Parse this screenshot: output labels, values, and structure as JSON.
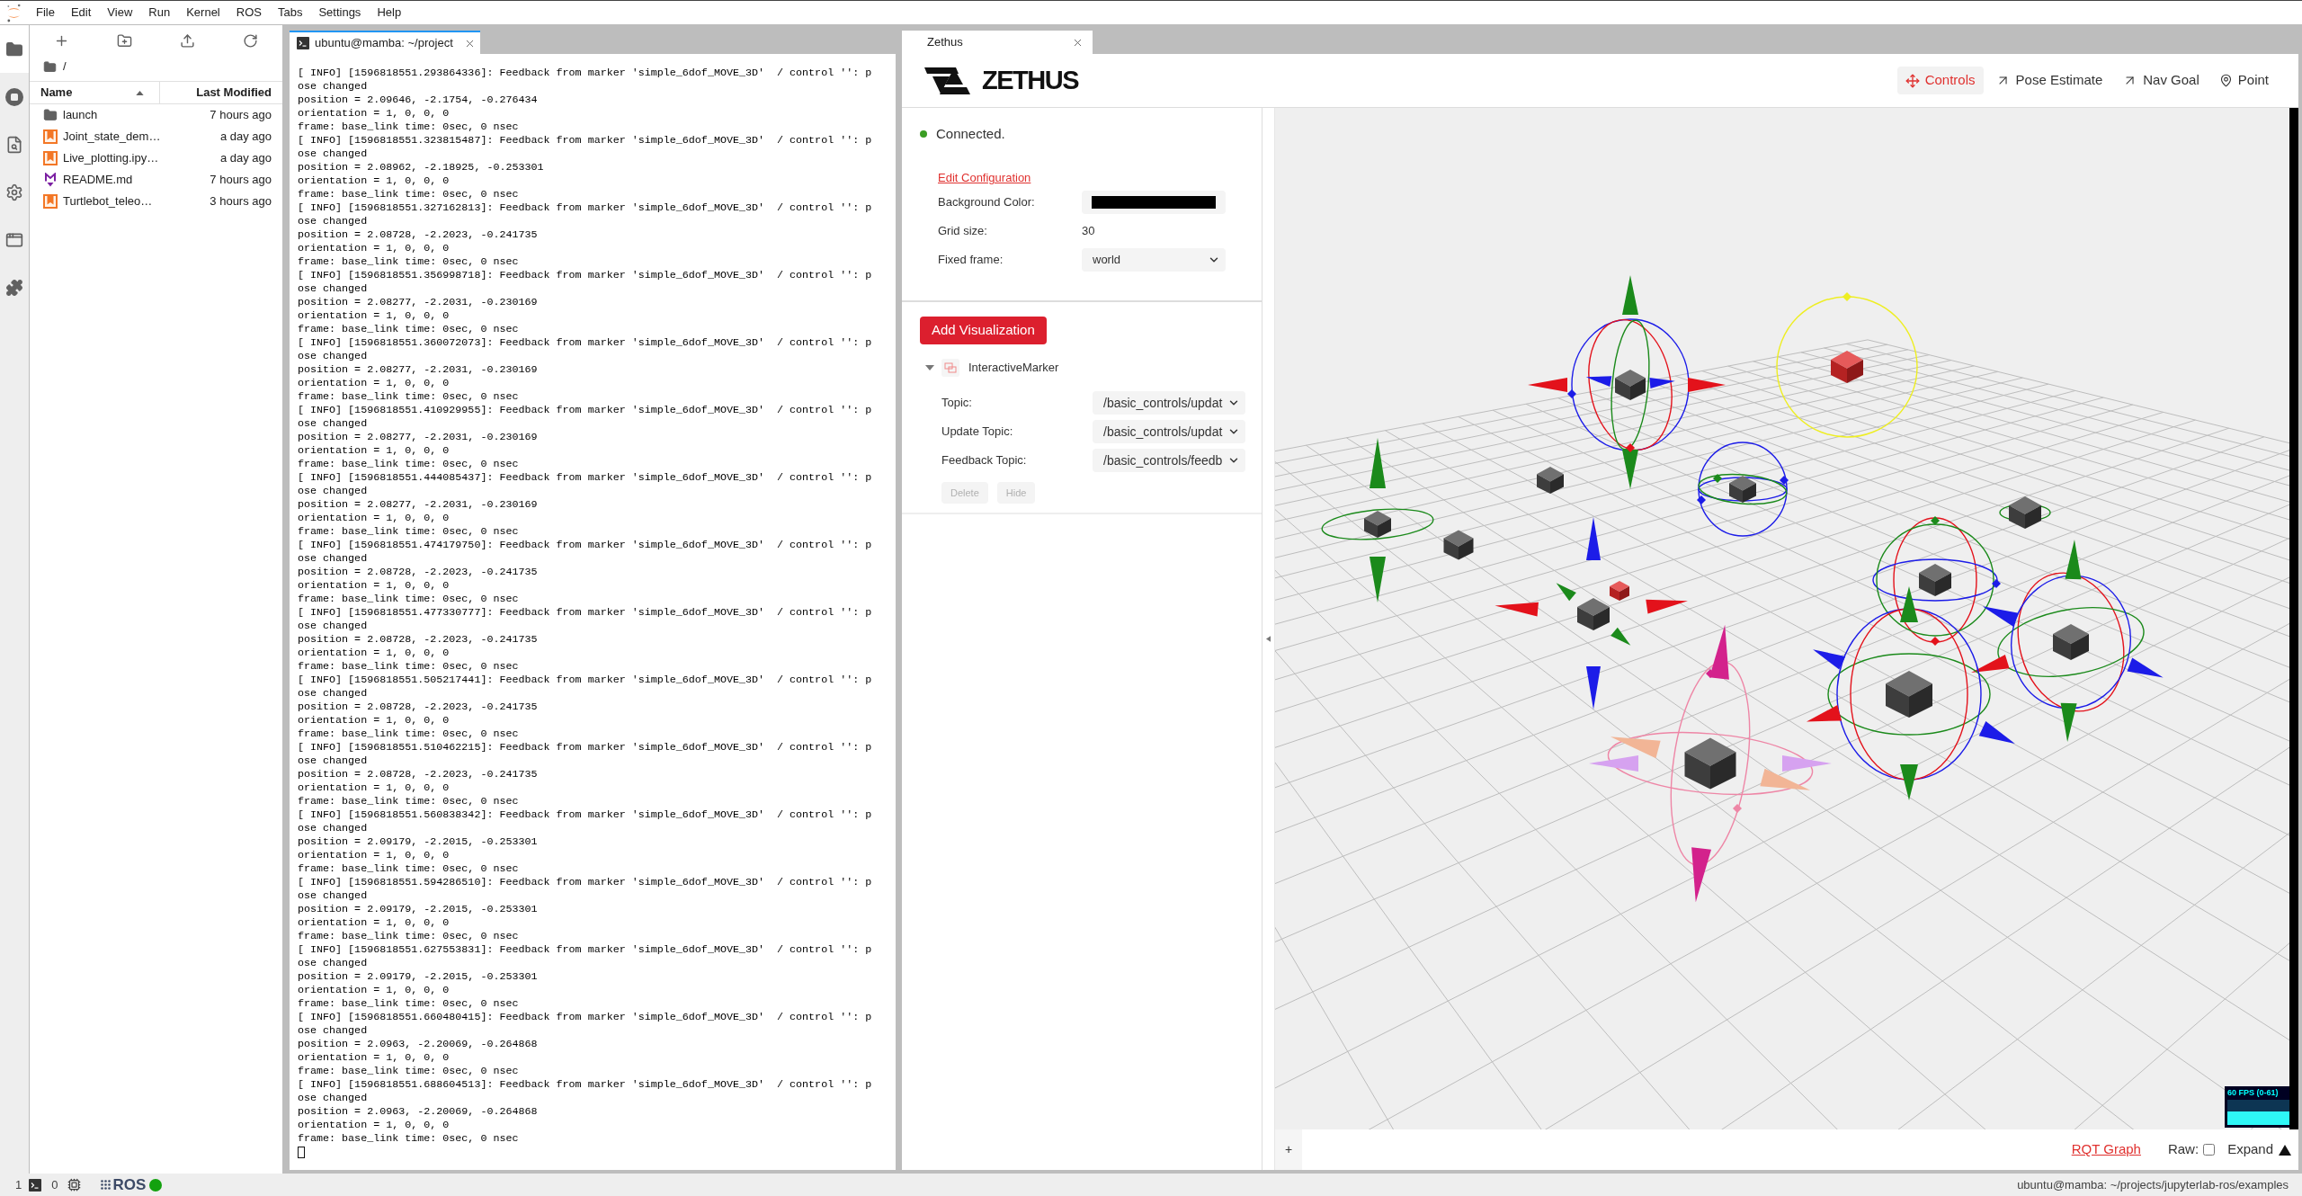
{
  "menu_bar": {
    "items": [
      "File",
      "Edit",
      "View",
      "Run",
      "Kernel",
      "ROS",
      "Tabs",
      "Settings",
      "Help"
    ]
  },
  "left_sidebar": {
    "tabs": [
      {
        "selected": true
      },
      {
        "selected": false
      },
      {
        "selected": false
      },
      {
        "selected": false
      },
      {
        "selected": false
      },
      {
        "selected": false
      }
    ]
  },
  "file_browser": {
    "breadcrumb": "/",
    "columns": [
      {
        "label": "Name",
        "sorted": true
      },
      {
        "label": "Last Modified",
        "sorted": false
      }
    ],
    "rows": [
      {
        "kind": "folder",
        "name": "launch",
        "modified": "7 hours ago"
      },
      {
        "kind": "notebook",
        "name": "Joint_state_dem…",
        "modified": "a day ago"
      },
      {
        "kind": "notebook",
        "name": "Live_plotting.ipy…",
        "modified": "a day ago"
      },
      {
        "kind": "markdown",
        "name": "README.md",
        "modified": "7 hours ago"
      },
      {
        "kind": "notebook",
        "name": "Turtlebot_teleo…",
        "modified": "3 hours ago"
      }
    ]
  },
  "terminal": {
    "tab": {
      "title": "ubuntu@mamba: ~/project",
      "focused": true
    },
    "lines": [
      "[ INFO] [1596818551.293864336]: Feedback from marker 'simple_6dof_MOVE_3D'  / control '': p",
      "ose changed",
      "position = 2.09646, -2.1754, -0.276434",
      "orientation = 1, 0, 0, 0",
      "frame: base_link time: 0sec, 0 nsec",
      "[ INFO] [1596818551.323815487]: Feedback from marker 'simple_6dof_MOVE_3D'  / control '': p",
      "ose changed",
      "position = 2.08962, -2.18925, -0.253301",
      "orientation = 1, 0, 0, 0",
      "frame: base_link time: 0sec, 0 nsec",
      "[ INFO] [1596818551.327162813]: Feedback from marker 'simple_6dof_MOVE_3D'  / control '': p",
      "ose changed",
      "position = 2.08728, -2.2023, -0.241735",
      "orientation = 1, 0, 0, 0",
      "frame: base_link time: 0sec, 0 nsec",
      "[ INFO] [1596818551.356998718]: Feedback from marker 'simple_6dof_MOVE_3D'  / control '': p",
      "ose changed",
      "position = 2.08277, -2.2031, -0.230169",
      "orientation = 1, 0, 0, 0",
      "frame: base_link time: 0sec, 0 nsec",
      "[ INFO] [1596818551.360072073]: Feedback from marker 'simple_6dof_MOVE_3D'  / control '': p",
      "ose changed",
      "position = 2.08277, -2.2031, -0.230169",
      "orientation = 1, 0, 0, 0",
      "frame: base_link time: 0sec, 0 nsec",
      "[ INFO] [1596818551.410929955]: Feedback from marker 'simple_6dof_MOVE_3D'  / control '': p",
      "ose changed",
      "position = 2.08277, -2.2031, -0.230169",
      "orientation = 1, 0, 0, 0",
      "frame: base_link time: 0sec, 0 nsec",
      "[ INFO] [1596818551.444085437]: Feedback from marker 'simple_6dof_MOVE_3D'  / control '': p",
      "ose changed",
      "position = 2.08277, -2.2031, -0.230169",
      "orientation = 1, 0, 0, 0",
      "frame: base_link time: 0sec, 0 nsec",
      "[ INFO] [1596818551.474179750]: Feedback from marker 'simple_6dof_MOVE_3D'  / control '': p",
      "ose changed",
      "position = 2.08728, -2.2023, -0.241735",
      "orientation = 1, 0, 0, 0",
      "frame: base_link time: 0sec, 0 nsec",
      "[ INFO] [1596818551.477330777]: Feedback from marker 'simple_6dof_MOVE_3D'  / control '': p",
      "ose changed",
      "position = 2.08728, -2.2023, -0.241735",
      "orientation = 1, 0, 0, 0",
      "frame: base_link time: 0sec, 0 nsec",
      "[ INFO] [1596818551.505217441]: Feedback from marker 'simple_6dof_MOVE_3D'  / control '': p",
      "ose changed",
      "position = 2.08728, -2.2023, -0.241735",
      "orientation = 1, 0, 0, 0",
      "frame: base_link time: 0sec, 0 nsec",
      "[ INFO] [1596818551.510462215]: Feedback from marker 'simple_6dof_MOVE_3D'  / control '': p",
      "ose changed",
      "position = 2.08728, -2.2023, -0.241735",
      "orientation = 1, 0, 0, 0",
      "frame: base_link time: 0sec, 0 nsec",
      "[ INFO] [1596818551.560838342]: Feedback from marker 'simple_6dof_MOVE_3D'  / control '': p",
      "ose changed",
      "position = 2.09179, -2.2015, -0.253301",
      "orientation = 1, 0, 0, 0",
      "frame: base_link time: 0sec, 0 nsec",
      "[ INFO] [1596818551.594286510]: Feedback from marker 'simple_6dof_MOVE_3D'  / control '': p",
      "ose changed",
      "position = 2.09179, -2.2015, -0.253301",
      "orientation = 1, 0, 0, 0",
      "frame: base_link time: 0sec, 0 nsec",
      "[ INFO] [1596818551.627553831]: Feedback from marker 'simple_6dof_MOVE_3D'  / control '': p",
      "ose changed",
      "position = 2.09179, -2.2015, -0.253301",
      "orientation = 1, 0, 0, 0",
      "frame: base_link time: 0sec, 0 nsec",
      "[ INFO] [1596818551.660480415]: Feedback from marker 'simple_6dof_MOVE_3D'  / control '': p",
      "ose changed",
      "position = 2.0963, -2.20069, -0.264868",
      "orientation = 1, 0, 0, 0",
      "frame: base_link time: 0sec, 0 nsec",
      "[ INFO] [1596818551.688604513]: Feedback from marker 'simple_6dof_MOVE_3D'  / control '': p",
      "ose changed",
      "position = 2.0963, -2.20069, -0.264868",
      "orientation = 1, 0, 0, 0",
      "frame: base_link time: 0sec, 0 nsec"
    ]
  },
  "zethus": {
    "tab": {
      "title": "Zethus",
      "focused": false
    },
    "logo_text": "ZETHUS",
    "toolbar": [
      {
        "label": "Controls",
        "selected": true
      },
      {
        "label": "Pose Estimate",
        "selected": false
      },
      {
        "label": "Nav Goal",
        "selected": false
      },
      {
        "label": "Point",
        "selected": false
      }
    ],
    "status": {
      "text": "Connected.",
      "connected": true
    },
    "config": {
      "link": "Edit Configuration",
      "fields": [
        {
          "kind": "color",
          "label": "Background Color:",
          "color": "#000000"
        },
        {
          "kind": "text",
          "label": "Grid size:",
          "value": "30"
        },
        {
          "kind": "select",
          "label": "Fixed frame:",
          "value": "world"
        }
      ]
    },
    "add_button": "Add Visualization",
    "visualizations": [
      {
        "name": "InteractiveMarker",
        "expanded": true,
        "fields": [
          {
            "label": "Topic:",
            "value": "/basic_controls/updat"
          },
          {
            "label": "Update Topic:",
            "value": "/basic_controls/updat"
          },
          {
            "label": "Feedback Topic:",
            "value": "/basic_controls/feedb"
          }
        ],
        "buttons": [
          {
            "label": "Delete",
            "disabled": true
          },
          {
            "label": "Hide",
            "disabled": true
          }
        ]
      }
    ],
    "viewer": {
      "fps": "60 FPS (0-61)"
    },
    "footer": {
      "add": "+",
      "link": "RQT Graph",
      "raw": {
        "label": "Raw:",
        "checked": false
      },
      "expand": "Expand"
    }
  },
  "status_bar": {
    "terminals": "1",
    "kernels": "0",
    "ros": {
      "label": "ROS",
      "connected": true
    },
    "path": "ubuntu@mamba: ~/projects/jupyterlab-ros/examples"
  }
}
